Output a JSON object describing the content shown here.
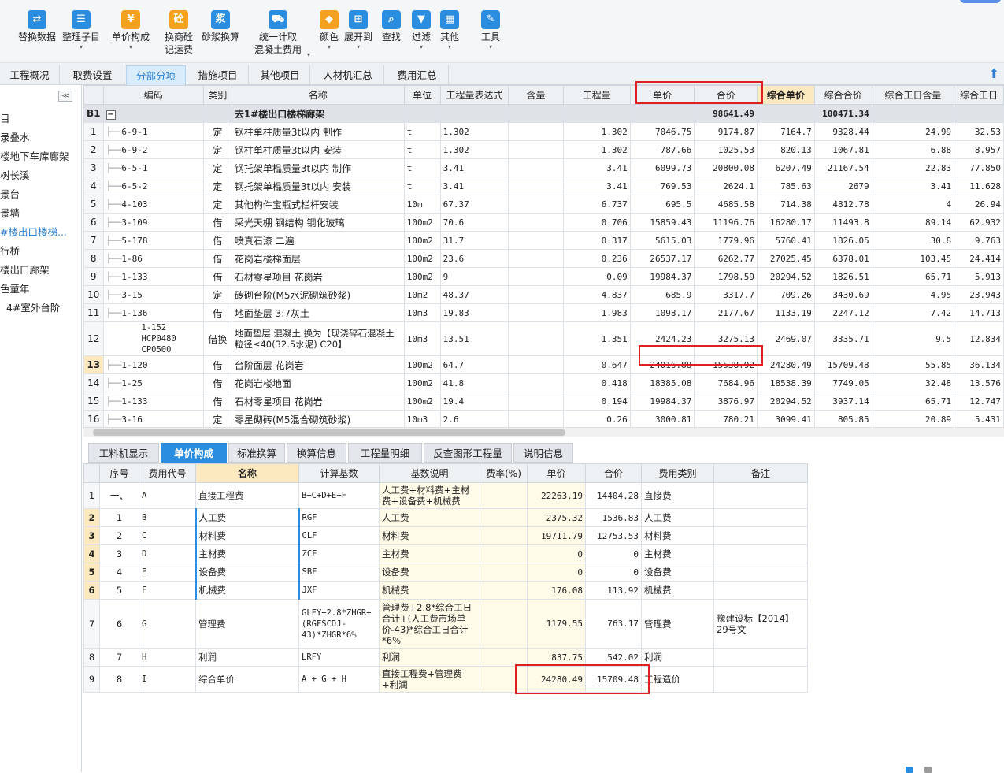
{
  "toolbar": [
    {
      "label": "替换数据",
      "icon": "replace-data-icon",
      "glyph": "⇄",
      "caret": false
    },
    {
      "label": "整理子目",
      "icon": "organize-items-icon",
      "glyph": "☰",
      "caret": true
    },
    {
      "label": "单价构成",
      "icon": "unit-price-icon",
      "glyph": "¥",
      "caret": true
    },
    {
      "label": "换商砼",
      "label2": "记运费",
      "icon": "concrete-icon",
      "glyph": "砼",
      "caret": false
    },
    {
      "label": "砂浆换算",
      "icon": "mortar-icon",
      "glyph": "浆",
      "caret": false
    },
    {
      "label": "统一计取",
      "label2": "混凝土费用",
      "icon": "unify-fee-icon",
      "glyph": "⛟",
      "caret": true
    },
    {
      "label": "颜色",
      "icon": "color-icon",
      "glyph": "◆",
      "caret": true
    },
    {
      "label": "展开到",
      "icon": "expand-to-icon",
      "glyph": "⊞",
      "caret": true
    },
    {
      "label": "查找",
      "icon": "find-icon",
      "glyph": "⌕",
      "caret": false
    },
    {
      "label": "过滤",
      "icon": "filter-icon",
      "glyph": "▼",
      "caret": true
    },
    {
      "label": "其他",
      "icon": "other-icon",
      "glyph": "▦",
      "caret": true
    },
    {
      "label": "工具",
      "icon": "tools-icon",
      "glyph": "✎",
      "caret": true
    }
  ],
  "main_tabs": [
    "工程概况",
    "取费设置",
    "分部分项",
    "措施项目",
    "其他项目",
    "人材机汇总",
    "费用汇总"
  ],
  "active_main_tab": "分部分项",
  "tree": [
    "目",
    "录叠水",
    "楼地下车库廊架",
    "树长溪",
    "景台",
    "景墙",
    "#楼出口楼梯...",
    "行桥",
    "楼出口廊架",
    "色童年",
    "4#室外台阶"
  ],
  "upper_table": {
    "headers": [
      "",
      "编码",
      "类别",
      "名称",
      "单位",
      "工程量表达式",
      "含量",
      "工程量",
      "单价",
      "合价",
      "综合单价",
      "综合合价",
      "综合工日含量",
      "综合工日"
    ],
    "group_row": {
      "id": "B1",
      "toggle": "−",
      "name": "去1#楼出口楼梯廊架",
      "hejia": "98641.49",
      "zonghe_hejia": "100471.34"
    },
    "rows": [
      {
        "n": "1",
        "code": "6-9-1",
        "type": "定",
        "name": "钢柱单柱质量3t以内 制作",
        "unit": "t",
        "expr": "1.302",
        "qty": "1.302",
        "price": "7046.75",
        "total": "9174.87",
        "cprice": "7164.7",
        "ctotal": "9328.44",
        "days": "24.99",
        "dtotal": "32.53"
      },
      {
        "n": "2",
        "code": "6-9-2",
        "type": "定",
        "name": "钢柱单柱质量3t以内 安装",
        "unit": "t",
        "expr": "1.302",
        "qty": "1.302",
        "price": "787.66",
        "total": "1025.53",
        "cprice": "820.13",
        "ctotal": "1067.81",
        "days": "6.88",
        "dtotal": "8.957"
      },
      {
        "n": "3",
        "code": "6-5-1",
        "type": "定",
        "name": "钢托架单榀质量3t以内 制作",
        "unit": "t",
        "expr": "3.41",
        "qty": "3.41",
        "price": "6099.73",
        "total": "20800.08",
        "cprice": "6207.49",
        "ctotal": "21167.54",
        "days": "22.83",
        "dtotal": "77.850"
      },
      {
        "n": "4",
        "code": "6-5-2",
        "type": "定",
        "name": "钢托架单榀质量3t以内 安装",
        "unit": "t",
        "expr": "3.41",
        "qty": "3.41",
        "price": "769.53",
        "total": "2624.1",
        "cprice": "785.63",
        "ctotal": "2679",
        "days": "3.41",
        "dtotal": "11.628"
      },
      {
        "n": "5",
        "code": "4-103",
        "type": "定",
        "name": "其他构件宝瓶式栏杆安装",
        "unit": "10m",
        "expr": "67.37",
        "qty": "6.737",
        "price": "695.5",
        "total": "4685.58",
        "cprice": "714.38",
        "ctotal": "4812.78",
        "days": "4",
        "dtotal": "26.94"
      },
      {
        "n": "6",
        "code": "3-109",
        "type": "借",
        "name": "采光天棚 钢结构 钢化玻璃",
        "unit": "100m2",
        "expr": "70.6",
        "qty": "0.706",
        "price": "15859.43",
        "total": "11196.76",
        "cprice": "16280.17",
        "ctotal": "11493.8",
        "days": "89.14",
        "dtotal": "62.932"
      },
      {
        "n": "7",
        "code": "5-178",
        "type": "借",
        "name": "喷真石漆 二遍",
        "unit": "100m2",
        "expr": "31.7",
        "qty": "0.317",
        "price": "5615.03",
        "total": "1779.96",
        "cprice": "5760.41",
        "ctotal": "1826.05",
        "days": "30.8",
        "dtotal": "9.763"
      },
      {
        "n": "8",
        "code": "1-86",
        "type": "借",
        "name": "花岗岩楼梯面层",
        "unit": "100m2",
        "expr": "23.6",
        "qty": "0.236",
        "price": "26537.17",
        "total": "6262.77",
        "cprice": "27025.45",
        "ctotal": "6378.01",
        "days": "103.45",
        "dtotal": "24.414"
      },
      {
        "n": "9",
        "code": "1-133",
        "type": "借",
        "name": "石材零星项目 花岗岩",
        "unit": "100m2",
        "expr": "9",
        "qty": "0.09",
        "price": "19984.37",
        "total": "1798.59",
        "cprice": "20294.52",
        "ctotal": "1826.51",
        "days": "65.71",
        "dtotal": "5.913"
      },
      {
        "n": "10",
        "code": "3-15",
        "type": "定",
        "name": "砖砌台阶(M5水泥砌筑砂浆)",
        "unit": "10m2",
        "expr": "48.37",
        "qty": "4.837",
        "price": "685.9",
        "total": "3317.7",
        "cprice": "709.26",
        "ctotal": "3430.69",
        "days": "4.95",
        "dtotal": "23.943"
      },
      {
        "n": "11",
        "code": "1-136",
        "type": "借",
        "name": "地面垫层 3:7灰土",
        "unit": "10m3",
        "expr": "19.83",
        "qty": "1.983",
        "price": "1098.17",
        "total": "2177.67",
        "cprice": "1133.19",
        "ctotal": "2247.12",
        "days": "7.42",
        "dtotal": "14.713"
      },
      {
        "n": "12",
        "code": "1-152 HCP0480 CP0500",
        "type": "借换",
        "name": "地面垫层 混凝土  换为【现浇碎石混凝土 粒径≤40(32.5水泥) C20】",
        "unit": "10m3",
        "expr": "13.51",
        "qty": "1.351",
        "price": "2424.23",
        "total": "3275.13",
        "cprice": "2469.07",
        "ctotal": "3335.71",
        "days": "9.5",
        "dtotal": "12.834"
      },
      {
        "n": "13",
        "code": "1-120",
        "type": "借",
        "name": "台阶面层 花岗岩",
        "unit": "100m2",
        "expr": "64.7",
        "qty": "0.647",
        "price": "24016.88",
        "total": "15538.92",
        "cprice": "24280.49",
        "ctotal": "15709.48",
        "days": "55.85",
        "dtotal": "36.134"
      },
      {
        "n": "14",
        "code": "1-25",
        "type": "借",
        "name": "花岗岩楼地面",
        "unit": "100m2",
        "expr": "41.8",
        "qty": "0.418",
        "price": "18385.08",
        "total": "7684.96",
        "cprice": "18538.39",
        "ctotal": "7749.05",
        "days": "32.48",
        "dtotal": "13.576"
      },
      {
        "n": "15",
        "code": "1-133",
        "type": "借",
        "name": "石材零星项目 花岗岩",
        "unit": "100m2",
        "expr": "19.4",
        "qty": "0.194",
        "price": "19984.37",
        "total": "3876.97",
        "cprice": "20294.52",
        "ctotal": "3937.14",
        "days": "65.71",
        "dtotal": "12.747"
      },
      {
        "n": "16",
        "code": "3-16",
        "type": "定",
        "name": "零星砌砖(M5混合砌筑砂浆)",
        "unit": "10m3",
        "expr": "2.6",
        "qty": "0.26",
        "price": "3000.81",
        "total": "780.21",
        "cprice": "3099.41",
        "ctotal": "805.85",
        "days": "20.89",
        "dtotal": "5.431"
      }
    ]
  },
  "bottom_tabs": [
    "工料机显示",
    "单价构成",
    "标准换算",
    "换算信息",
    "工程量明细",
    "反查图形工程量",
    "说明信息"
  ],
  "active_bottom_tab": "单价构成",
  "lower_table": {
    "headers": [
      "",
      "序号",
      "费用代号",
      "名称",
      "计算基数",
      "基数说明",
      "费率(%)",
      "单价",
      "合价",
      "费用类别",
      "备注"
    ],
    "rows": [
      {
        "n": "1",
        "seq": "一、",
        "code": "A",
        "name": "直接工程费",
        "base": "B+C+D+E+F",
        "desc": "人工费+材料费+主材费+设备费+机械费",
        "rate": "",
        "price": "22263.19",
        "total": "14404.28",
        "cat": "直接费",
        "note": ""
      },
      {
        "n": "2",
        "seq": "1",
        "code": "B",
        "name": "人工费",
        "base": "RGF",
        "desc": "人工费",
        "rate": "",
        "price": "2375.32",
        "total": "1536.83",
        "cat": "人工费",
        "note": ""
      },
      {
        "n": "3",
        "seq": "2",
        "code": "C",
        "name": "材料费",
        "base": "CLF",
        "desc": "材料费",
        "rate": "",
        "price": "19711.79",
        "total": "12753.53",
        "cat": "材料费",
        "note": ""
      },
      {
        "n": "4",
        "seq": "3",
        "code": "D",
        "name": "主材费",
        "base": "ZCF",
        "desc": "主材费",
        "rate": "",
        "price": "0",
        "total": "0",
        "cat": "主材费",
        "note": ""
      },
      {
        "n": "5",
        "seq": "4",
        "code": "E",
        "name": "设备费",
        "base": "SBF",
        "desc": "设备费",
        "rate": "",
        "price": "0",
        "total": "0",
        "cat": "设备费",
        "note": ""
      },
      {
        "n": "6",
        "seq": "5",
        "code": "F",
        "name": "机械费",
        "base": "JXF",
        "desc": "机械费",
        "rate": "",
        "price": "176.08",
        "total": "113.92",
        "cat": "机械费",
        "note": ""
      },
      {
        "n": "7",
        "seq": "6",
        "code": "G",
        "name": "管理费",
        "base": "GLFY+2.8*ZHGR+(RGFSCDJ-43)*ZHGR*6%",
        "desc": "管理费+2.8*综合工日合计+(人工费市场单价-43)*综合工日合计*6%",
        "rate": "",
        "price": "1179.55",
        "total": "763.17",
        "cat": "管理费",
        "note": "豫建设标【2014】29号文"
      },
      {
        "n": "8",
        "seq": "7",
        "code": "H",
        "name": "利润",
        "base": "LRFY",
        "desc": "利润",
        "rate": "",
        "price": "837.75",
        "total": "542.02",
        "cat": "利润",
        "note": ""
      },
      {
        "n": "9",
        "seq": "8",
        "code": "I",
        "name": "综合单价",
        "base": "A + G + H",
        "desc": "直接工程费+管理费+利润",
        "rate": "",
        "price": "24280.49",
        "total": "15709.48",
        "cat": "工程造价",
        "note": ""
      }
    ]
  }
}
